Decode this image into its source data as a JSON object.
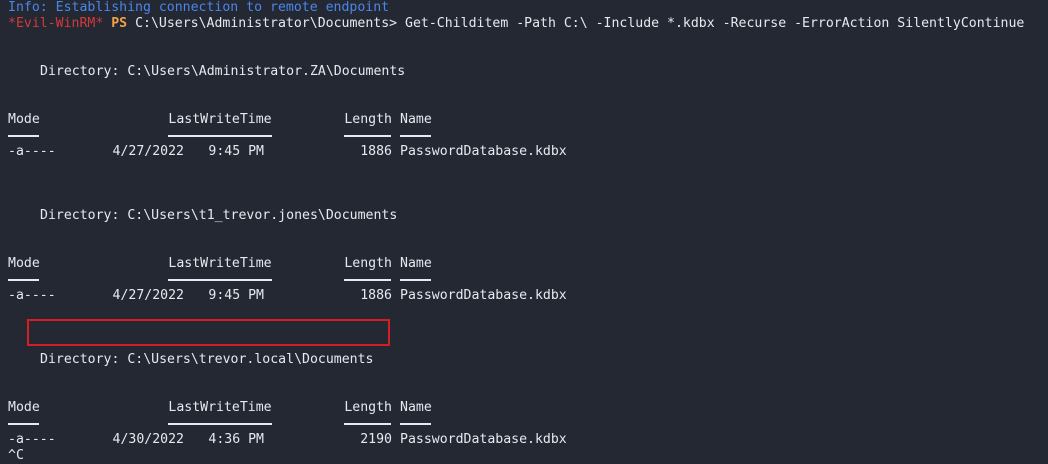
{
  "info_line": "Info: Establishing connection to remote endpoint",
  "prompt": {
    "host": "*Evil-WinRM*",
    "ps": "PS",
    "path": "C:\\Users\\Administrator\\Documents>",
    "command": "Get-Childitem -Path C:\\ -Include *.kdbx -Recurse -ErrorAction SilentlyContinue"
  },
  "headers": {
    "mode": "Mode",
    "lastwritetime": "LastWriteTime",
    "length": "Length",
    "name": "Name"
  },
  "listings": [
    {
      "directory": "Directory: C:\\Users\\Administrator.ZA\\Documents",
      "mode": "-a----",
      "date": "4/27/2022",
      "time": "9:45 PM",
      "length": "1886",
      "name": "PasswordDatabase.kdbx"
    },
    {
      "directory": "Directory: C:\\Users\\t1_trevor.jones\\Documents",
      "mode": "-a----",
      "date": "4/27/2022",
      "time": "9:45 PM",
      "length": "1886",
      "name": "PasswordDatabase.kdbx"
    },
    {
      "directory": "Directory: C:\\Users\\trevor.local\\Documents",
      "mode": "-a----",
      "date": "4/30/2022",
      "time": "4:36 PM",
      "length": "2190",
      "name": "PasswordDatabase.kdbx"
    }
  ],
  "interrupt": "^C",
  "colors": {
    "background": "#232833",
    "text": "#e7e9ee",
    "info": "#4c86e8",
    "prompt_host": "#d33a3a",
    "prompt_ps": "#f2a14a",
    "highlight_box": "#d51d24"
  }
}
